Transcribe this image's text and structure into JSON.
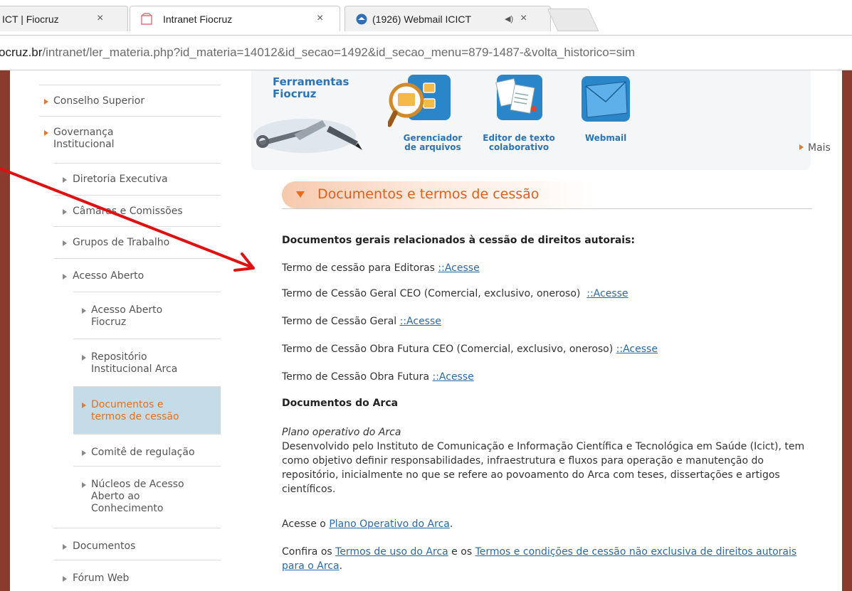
{
  "browser": {
    "tabs": [
      {
        "label": "ICT | Fiocruz",
        "close": "×"
      },
      {
        "label": "Intranet Fiocruz",
        "close": "×"
      },
      {
        "label": "(1926) Webmail ICICT",
        "audio": "◀)",
        "close": "×"
      }
    ],
    "url_host": "ocruz.br",
    "url_path": "/intranet/ler_materia.php?id_materia=14012&id_secao=1492&id_secao_menu=879-1487-&volta_historico=sim"
  },
  "sidebar": {
    "items": [
      {
        "label": "Conselho Superior"
      },
      {
        "label": "Governança",
        "label2": "Institucional"
      },
      {
        "label": "Diretoria Executiva"
      },
      {
        "label": "Câmaras e Comissões"
      },
      {
        "label": "Grupos de Trabalho"
      },
      {
        "label": "Acesso Aberto"
      },
      {
        "label": "Acesso Aberto",
        "label2": "Fiocruz"
      },
      {
        "label": "Repositório",
        "label2": "Institucional Arca"
      },
      {
        "label": "Documentos e",
        "label2": "termos de cessão"
      },
      {
        "label": "Comitê de regulação"
      },
      {
        "label": "Núcleos de Acesso",
        "label2": "Aberto ao",
        "label3": "Conhecimento"
      },
      {
        "label": "Documentos"
      },
      {
        "label": "Fórum Web"
      }
    ]
  },
  "tools": {
    "title_line1": "Ferramentas",
    "title_line2": "Fiocruz",
    "file_manager_line1": "Gerenciador",
    "file_manager_line2": "de arquivos",
    "editor_line1": "Editor de texto",
    "editor_line2": "colaborativo",
    "webmail": "Webmail",
    "more": "Mais"
  },
  "section": {
    "title": "Documentos e termos de cessão"
  },
  "content": {
    "heading1": "Documentos gerais relacionados à cessão de direitos autorais:",
    "rows": [
      {
        "text": "Termo de cessão para Editoras ",
        "link": "::Acesse"
      },
      {
        "text": "Termo de Cessão Geral CEO (Comercial, exclusivo, oneroso)  ",
        "link": "::Acesse"
      },
      {
        "text": "Termo de Cessão Geral ",
        "link": "::Acesse"
      },
      {
        "text": "Termo de Cessão Obra Futura CEO (Comercial, exclusivo, oneroso) ",
        "link": "::Acesse"
      },
      {
        "text": "Termo de Cessão Obra Futura ",
        "link": "::Acesse"
      }
    ],
    "heading2": "Documentos do Arca",
    "plan_title": "Plano operativo do Arca",
    "plan_desc": "Desenvolvido pelo Instituto de Comunicação e Informação Científica e Tecnológica em Saúde (Icict), tem como objetivo definir responsabilidades, infraestrutura e fluxos para operação e manutenção do repositório, inicialmente no que se refere ao povoamento do Arca com teses, dissertações e artigos científicos.",
    "access_prefix": "Acesse o ",
    "access_link": "Plano Operativo do Arca",
    "access_suffix": ".",
    "confira_prefix": "Confira os ",
    "terms_link": "Termos de uso do Arca",
    "confira_mid": " e os ",
    "conditions_link": "Termos e condições de cessão não exclusiva de direitos autorais para o Arca",
    "confira_suffix": "."
  },
  "colors": {
    "accent_orange": "#e05f1a",
    "link_blue": "#2a6aa6",
    "tools_blue": "#2c74b3",
    "active_bg": "#c5dce8",
    "annotation_red": "#e01010",
    "frame_brown": "#8b3b2e"
  }
}
